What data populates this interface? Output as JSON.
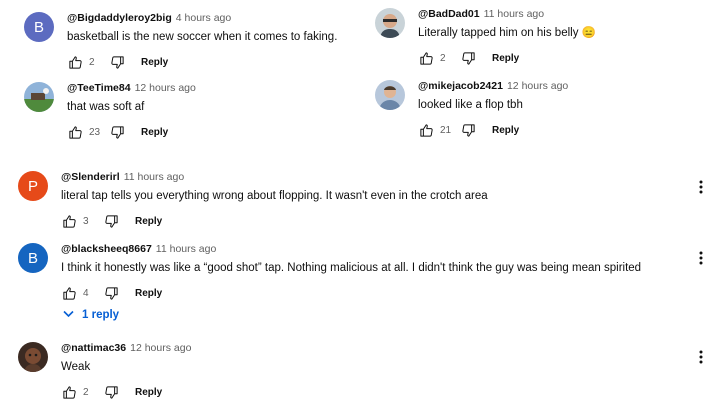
{
  "colors": {
    "avatar_b": "#5c6bc0",
    "avatar_p": "#e64a19",
    "link": "#065fd4"
  },
  "icons": {
    "like": "thumb-up-icon",
    "dislike": "thumb-down-icon",
    "menu": "more-vert-icon",
    "expand": "chevron-down-icon"
  },
  "reply_label": "Reply",
  "top_left": [
    {
      "avatar_letter": "B",
      "author": "@Bigdaddyleroy2big",
      "time": "4 hours ago",
      "text": "basketball is the new soccer when it comes to faking.",
      "likes": "2"
    },
    {
      "author": "@TeeTime84",
      "time": "12 hours ago",
      "text": "that was soft af",
      "likes": "23"
    }
  ],
  "top_right": [
    {
      "author": "@BadDad01",
      "time": "11 hours ago",
      "text": "Literally tapped him on his belly 😑",
      "likes": "2"
    },
    {
      "author": "@mikejacob2421",
      "time": "12 hours ago",
      "text": "looked like a flop tbh",
      "likes": "21"
    }
  ],
  "main": [
    {
      "avatar_letter": "P",
      "author": "@Slenderirl",
      "time": "11 hours ago",
      "text": "literal tap tells you everything wrong about flopping. It wasn't even in the crotch area",
      "likes": "3"
    },
    {
      "avatar_letter": "B",
      "author": "@blacksheeq8667",
      "time": "11 hours ago",
      "text": "I think it honestly was like a “good shot” tap. Nothing malicious at all.  I didn't think the guy was being mean spirited",
      "likes": "4",
      "replies_label": "1 reply"
    },
    {
      "author": "@nattimac36",
      "time": "12 hours ago",
      "text": "Weak",
      "likes": "2"
    }
  ]
}
